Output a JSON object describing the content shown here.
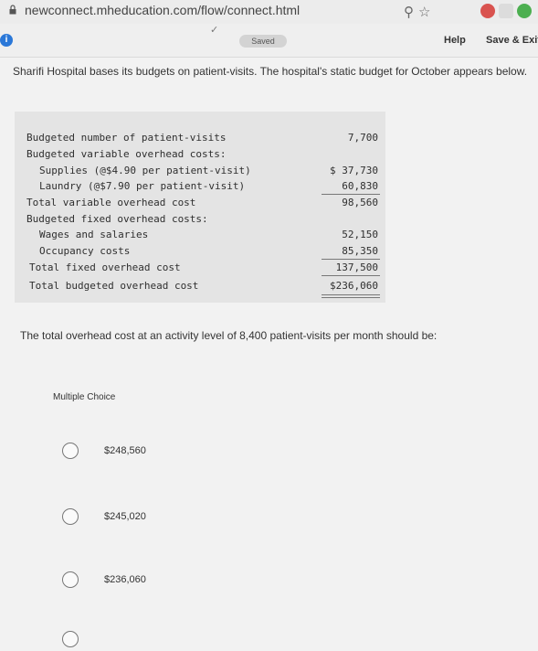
{
  "browser": {
    "url": "newconnect.mheducation.com/flow/connect.html"
  },
  "appbar": {
    "saved_label": "Saved",
    "help_label": "Help",
    "save_exit_label": "Save & Exit"
  },
  "question": {
    "intro": "Sharifi Hospital bases its budgets on patient-visits. The hospital's static budget for October appears below.",
    "prompt": "The total overhead cost at an activity level of 8,400 patient-visits per month should be:"
  },
  "budget_table": [
    {
      "label": "Budgeted number of patient-visits",
      "indent": 0,
      "value": "7,700"
    },
    {
      "label": "Budgeted variable overhead costs:",
      "indent": 0,
      "value": ""
    },
    {
      "label": "Supplies (@$4.90 per patient-visit)",
      "indent": 2,
      "value": "$ 37,730"
    },
    {
      "label": "Laundry (@$7.90 per patient-visit)",
      "indent": 2,
      "value": "60,830"
    },
    {
      "label": "Total variable overhead cost",
      "indent": 0,
      "value": "98,560"
    },
    {
      "label": "Budgeted fixed overhead costs:",
      "indent": 0,
      "value": ""
    },
    {
      "label": "Wages and salaries",
      "indent": 1,
      "value": "52,150"
    },
    {
      "label": "Occupancy costs",
      "indent": 1,
      "value": "85,350"
    },
    {
      "label": "Total fixed overhead cost",
      "indent": 0,
      "value": "137,500"
    },
    {
      "label": "Total budgeted overhead cost",
      "indent": 0,
      "value": "$236,060"
    }
  ],
  "multiple_choice": {
    "label": "Multiple Choice",
    "options": [
      "$248,560",
      "$245,020",
      "$236,060"
    ]
  }
}
